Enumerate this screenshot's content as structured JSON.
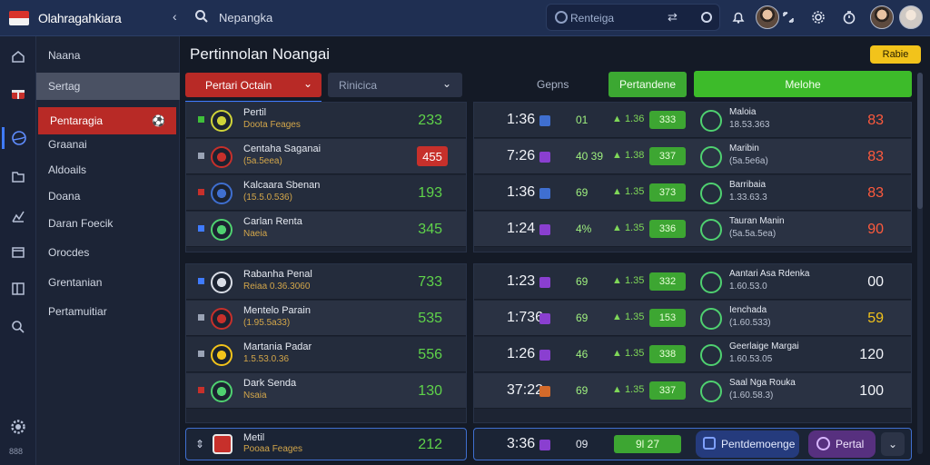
{
  "header": {
    "app_name": "Olahragahkiara",
    "search_text": "Nepangka",
    "search_box_placeholder": "Renteiga",
    "search_box_shuffle": "⇄",
    "back": "‹",
    "icons": [
      "shuffle-icon",
      "record-icon",
      "bell-icon",
      "avatar",
      "expand-icon",
      "settings-icon",
      "timer-icon",
      "avatar"
    ]
  },
  "sidebar": {
    "items": [
      {
        "label": "Naana"
      },
      {
        "label": "Sertag"
      },
      {
        "label": "Pentaragia"
      },
      {
        "label": "Graanai"
      },
      {
        "label": "Aldoails"
      },
      {
        "label": "Doana"
      },
      {
        "label": "Daran Foecik"
      },
      {
        "label": "Orocdes"
      },
      {
        "label": "Grentanian"
      },
      {
        "label": "Pertamuitiar"
      }
    ],
    "rail_label": "888"
  },
  "main": {
    "title": "Pertinnolan Noangai",
    "live_badge": "Rabie",
    "dropdown1": "Pertari Octain",
    "dropdown2": "Rinicica",
    "col_games": "Gepns",
    "btn_green1": "Pertandene",
    "btn_green2": "Melohe"
  },
  "left_rows": [
    {
      "name": "Pertil",
      "sub": "Doota Feages",
      "score": "233",
      "mark": "#3fbf3a",
      "crest": "#cfd339",
      "boxed": false
    },
    {
      "name": "Centaha Saganai",
      "sub": "(5a.5eea)",
      "score": "455",
      "mark": "#9aa3b5",
      "crest": "#c7302b",
      "boxed": true
    },
    {
      "name": "Kalcaara Sbenan",
      "sub": "(15.5.0.536)",
      "score": "193",
      "mark": "#c7302b",
      "crest": "#3f6fd0",
      "boxed": false
    },
    {
      "name": "Carlan Renta",
      "sub": "Naeia",
      "score": "345",
      "mark": "#3f7bff",
      "crest": "#4fd170",
      "boxed": false
    },
    {
      "name": "Rabanha Penal",
      "sub": "Reiaa 0.36.3060",
      "score": "733",
      "mark": "#3f7bff",
      "crest": "#d9dde6",
      "boxed": false
    },
    {
      "name": "Mentelo Parain",
      "sub": "(1.95.5a33)",
      "score": "535",
      "mark": "#9aa3b5",
      "crest": "#c7302b",
      "boxed": false
    },
    {
      "name": "Martania Padar",
      "sub": "1.5.53.0.36",
      "score": "556",
      "mark": "#9aa3b5",
      "crest": "#f2c31b",
      "boxed": false
    },
    {
      "name": "Dark Senda",
      "sub": "Nsaia",
      "score": "130",
      "mark": "#c7302b",
      "crest": "#4fd170",
      "boxed": false
    }
  ],
  "right_rows": [
    {
      "time": "1:36",
      "sq": "#3f6fd0",
      "small": "01",
      "arrow": "▲ 1.36",
      "pill": "333",
      "name": "Maloia",
      "sub": "18.53.363",
      "val": "83"
    },
    {
      "time": "7:26",
      "sq": "#8a3fd0",
      "small": "40 39",
      "arrow": "▲ 1.38",
      "pill": "337",
      "name": "Maribin",
      "sub": "(5a.5e6a)",
      "val": "83"
    },
    {
      "time": "1:36",
      "sq": "#3f6fd0",
      "small": "69",
      "arrow": "▲ 1.35",
      "pill": "373",
      "name": "Barribaia",
      "sub": "1.33.63.3",
      "val": "83"
    },
    {
      "time": "1:24",
      "sq": "#8a3fd0",
      "small": "4%",
      "arrow": "▲ 1.35",
      "pill": "336",
      "name": "Tauran Manin",
      "sub": "(5a.5a.5ea)",
      "val": "90"
    },
    {
      "time": "1:23",
      "sq": "#8a3fd0",
      "small": "69",
      "arrow": "▲ 1.35",
      "pill": "332",
      "name": "Aantari Asa Rdenka",
      "sub": "1.60.53.0",
      "val": "00"
    },
    {
      "time": "1:736",
      "sq": "#8a3fd0",
      "small": "69",
      "arrow": "▲ 1.35",
      "pill": "153",
      "name": "Ienchada",
      "sub": "(1.60.533)",
      "val": "59"
    },
    {
      "time": "1:26",
      "sq": "#8a3fd0",
      "small": "46",
      "arrow": "▲ 1.35",
      "pill": "338",
      "name": "Geerlaige Margai",
      "sub": "1.60.53.05",
      "val": "120"
    },
    {
      "time": "37:22",
      "sq": "#d36a2a",
      "small": "69",
      "arrow": "▲ 1.35",
      "pill": "337",
      "name": "Saal Nga Rouka",
      "sub": "(1.60.58.3)",
      "val": "100"
    }
  ],
  "footer": {
    "left_name": "Metil",
    "left_sub": "Pooaa Feages",
    "left_score": "212",
    "right_time": "3:36",
    "right_small": "09",
    "right_pill": "9l 27",
    "btn_blue": "Pentdemoenge",
    "btn_purple": "Pertal"
  }
}
